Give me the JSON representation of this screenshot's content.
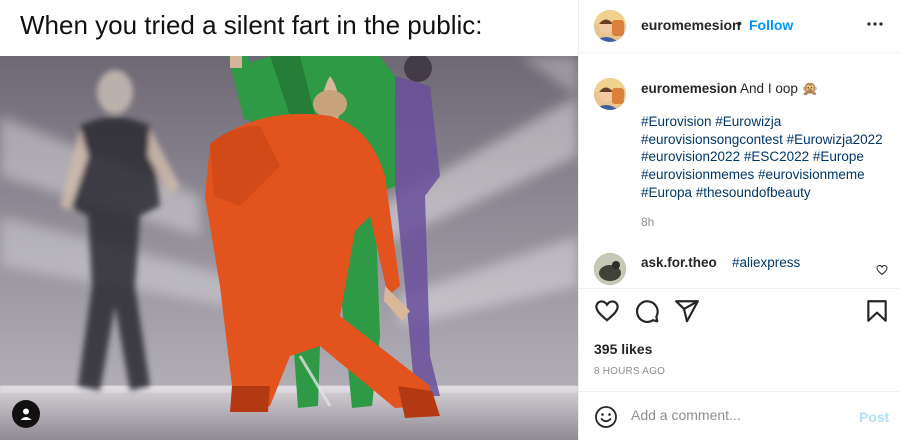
{
  "meme": {
    "caption": "When you tried a silent fart in the public:"
  },
  "post": {
    "username": "euromemesion",
    "separator": "•",
    "follow_label": "Follow",
    "caption_user": "euromemesion",
    "caption_text": "And I oop 🙊",
    "hashtags": "#Eurovision #Eurowizja #eurovisionsongcontest #Eurowizja2022 #eurovision2022 #ESC2022 #Europe #eurovisionmemes #eurovisionmeme #Europa #thesoundofbeauty",
    "caption_time": "8h",
    "comment": {
      "user": "ask.for.theo",
      "text": "#aliexpress"
    },
    "likes": "395 likes",
    "time_ago": "8 HOURS AGO",
    "add_comment_placeholder": "Add a comment...",
    "post_label": "Post"
  },
  "icons": {
    "more": "more-options-icon",
    "like": "heart-icon",
    "comment": "comment-icon",
    "share": "share-icon",
    "save": "bookmark-icon",
    "emoji": "emoji-icon",
    "tag": "user-tag-icon"
  },
  "colors": {
    "link": "#0095f6",
    "hashtag": "#00376b",
    "muted": "#8e8e8e",
    "post_disabled": "#b2dffc"
  }
}
